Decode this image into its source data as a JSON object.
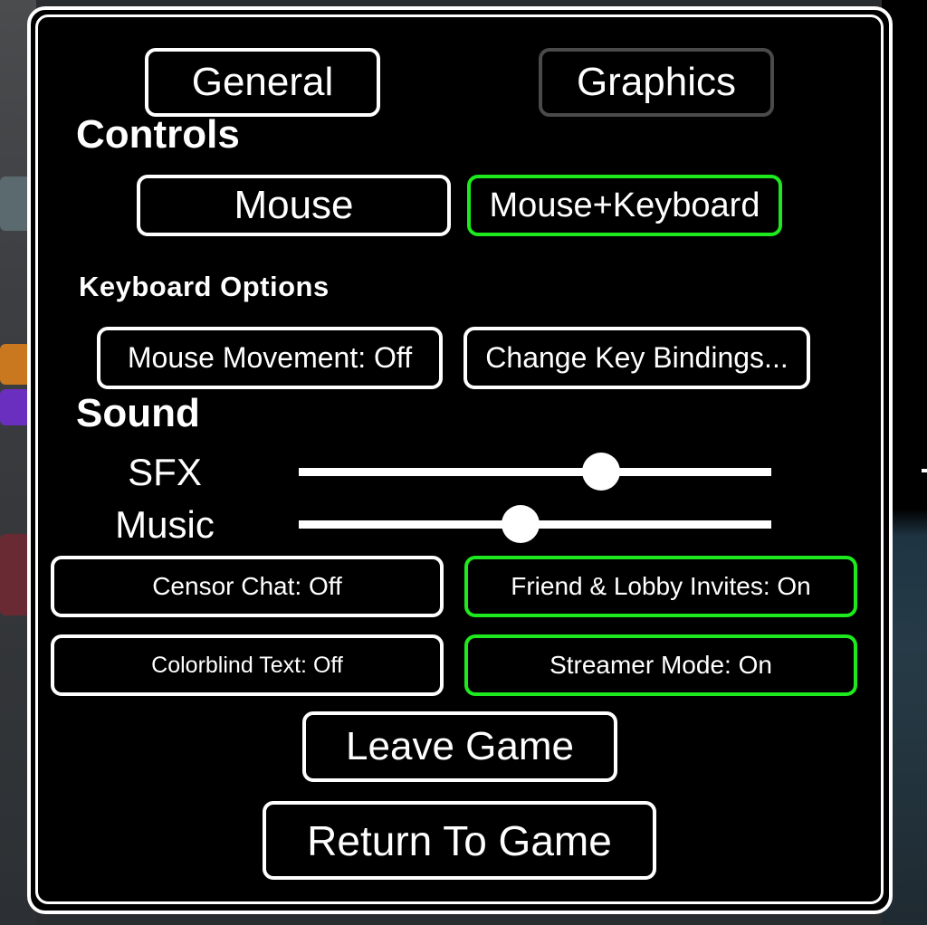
{
  "tabs": [
    {
      "label": "General",
      "state": "selected"
    },
    {
      "label": "Graphics",
      "state": "unselected"
    }
  ],
  "controls": {
    "heading": "Controls",
    "options": [
      {
        "label": "Mouse",
        "active": false
      },
      {
        "label": "Mouse+Keyboard",
        "active": true
      }
    ]
  },
  "keyboard_options": {
    "heading": "Keyboard Options",
    "mouse_movement": "Mouse Movement: Off",
    "change_bindings": "Change Key Bindings..."
  },
  "sound": {
    "heading": "Sound",
    "sliders": [
      {
        "label": "SFX",
        "value_percent": 64
      },
      {
        "label": "Music",
        "value_percent": 47
      }
    ]
  },
  "toggles": [
    {
      "label": "Censor Chat: Off",
      "on": false
    },
    {
      "label": "Friend & Lobby Invites: On",
      "on": true
    },
    {
      "label": "Colorblind Text: Off",
      "on": false
    },
    {
      "label": "Streamer Mode: On",
      "on": true
    }
  ],
  "actions": {
    "leave": "Leave Game",
    "return": "Return To Game"
  },
  "colors": {
    "active_border": "#1ee81e",
    "default_border": "#ffffff",
    "inactive_tab_border": "#4a4a4a",
    "panel_bg": "#000000"
  }
}
